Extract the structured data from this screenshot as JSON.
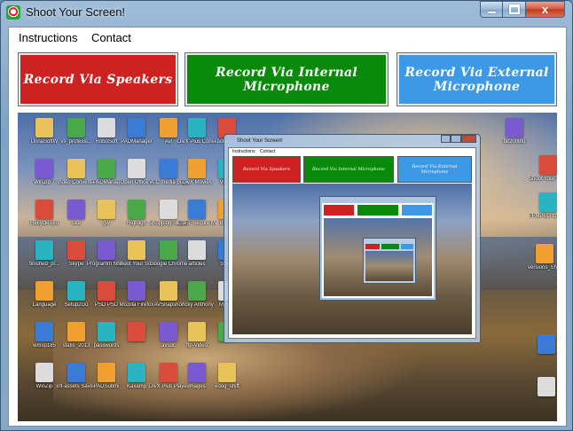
{
  "window": {
    "title": "Shoot Your Screen!",
    "caption_buttons": {
      "minimize": "minimize",
      "maximize": "maximize",
      "close": "x"
    }
  },
  "menu": {
    "items": [
      {
        "label": "Instructions"
      },
      {
        "label": "Contact"
      }
    ]
  },
  "record_buttons": [
    {
      "label": "Record Via Speakers",
      "color": "#cc2222"
    },
    {
      "label": "Record Via Internal Microphone",
      "color": "#0a8a0a"
    },
    {
      "label": "Record Via External Microphone",
      "color": "#3d98e6"
    }
  ],
  "preview": {
    "desktop_icons": [
      "UnnaSoftW",
      "vs_professi...",
      "RoboSoft ",
      "PADManager",
      "Avi",
      "DivX Plus Converter",
      "scheet.x",
      "WinZip 7",
      "Video Converter",
      "PADManag",
      "Open Office 4",
      "VLC media player",
      "DivX Movies",
      "Versio",
      "Recycle Bin",
      "Site",
      "gw",
      "Highligh",
      "Shopping Support",
      "ESET Secure Manager",
      "Blog 4",
      "finished_pl...",
      "Skype",
      "Programm Notepad",
      "Shoot Your Screen",
      "Google Chrome",
      "articles",
      "Shoot",
      "Language",
      "Setup2Go",
      "PSD PSD",
      "Mozilla Firefox",
      "AVSnapshot",
      "Vicky Anthony",
      "MWisc",
      "wmsp185",
      "static_2013",
      "passwords",
      "",
      "avsdc",
      "ftp-Video",
      "",
      "WinZip",
      "inf-assets Saver 7.1",
      "PADSubmi",
      "Kaxamp",
      "DivX Plus Player",
      "images",
      "edog_shift",
      "bit2008fu",
      "Shoot Your Screen",
      "FFMPEG commands",
      "versions_Sh..."
    ],
    "inner_window_title": "Shoot Your Screen!",
    "inner_menu": [
      "Instructions",
      "Contact"
    ]
  },
  "icons": {
    "app": "target-icon",
    "minimize": "minimize-icon",
    "maximize": "maximize-icon",
    "close": "close-icon"
  }
}
